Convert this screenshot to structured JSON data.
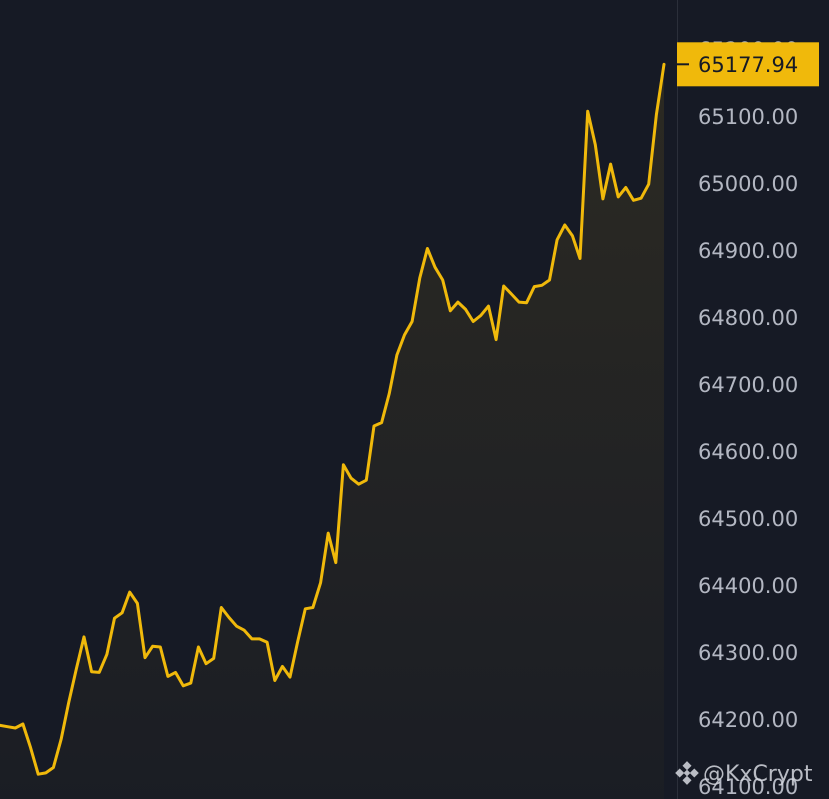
{
  "chart_data": {
    "type": "area",
    "line_color": "#f0b90b",
    "axis_side": "right",
    "last_price": "65177.94",
    "y_ticks": [
      "65200.00",
      "65100.00",
      "65000.00",
      "64900.00",
      "64800.00",
      "64700.00",
      "64600.00",
      "64500.00",
      "64400.00",
      "64300.00",
      "64200.00",
      "64100.00"
    ],
    "ylim": [
      64081,
      65274
    ],
    "values": [
      64191,
      64189,
      64187,
      64193,
      64158,
      64118,
      64120,
      64128,
      64170,
      64225,
      64275,
      64323,
      64271,
      64270,
      64297,
      64351,
      64359,
      64390,
      64373,
      64292,
      64309,
      64308,
      64264,
      64270,
      64250,
      64254,
      64308,
      64283,
      64291,
      64367,
      64352,
      64339,
      64333,
      64320,
      64320,
      64315,
      64258,
      64279,
      64263,
      64316,
      64365,
      64367,
      64404,
      64478,
      64434,
      64580,
      64560,
      64551,
      64557,
      64638,
      64643,
      64686,
      64744,
      64774,
      64794,
      64859,
      64903,
      64875,
      64856,
      64810,
      64823,
      64812,
      64794,
      64803,
      64817,
      64767,
      64847,
      64835,
      64823,
      64822,
      64846,
      64848,
      64856,
      64916,
      64938,
      64922,
      64888,
      65108,
      65058,
      64977,
      65029,
      64980,
      64994,
      64975,
      64978,
      64999,
      65103,
      65177.94
    ],
    "title": "",
    "xlabel": "",
    "ylabel": ""
  },
  "watermark": {
    "text": "@KxCrypt",
    "icon": "binance-diamond-icon"
  }
}
